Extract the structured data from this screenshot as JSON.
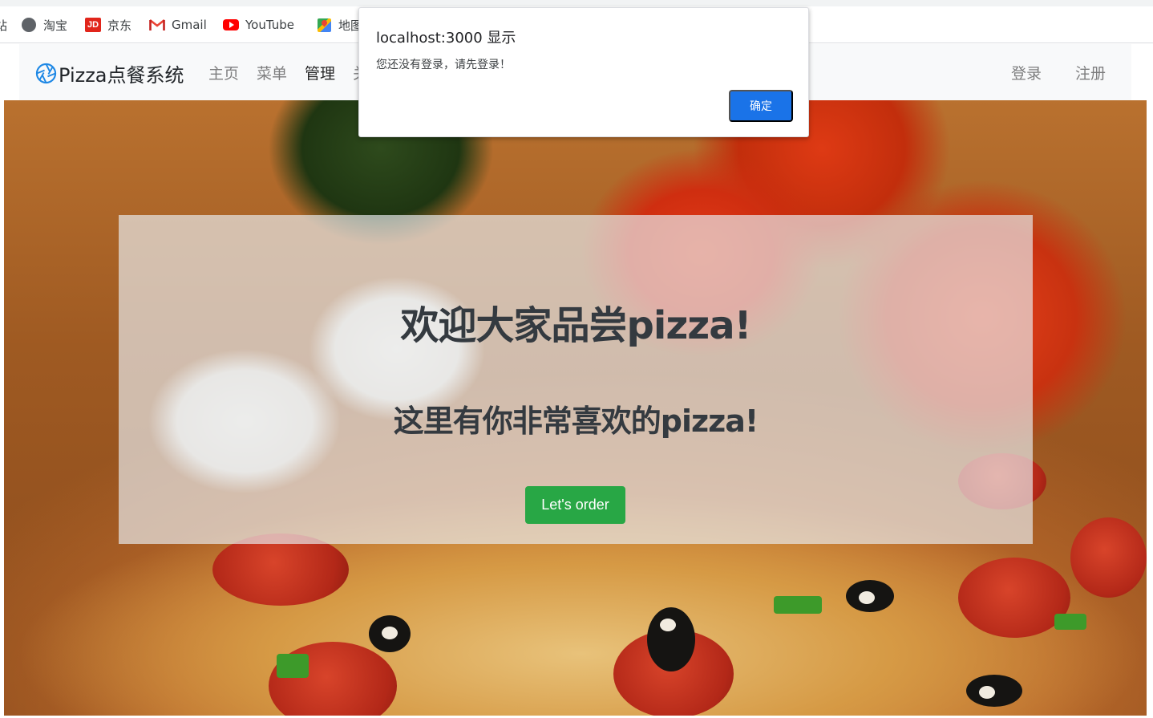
{
  "bookmarks": [
    {
      "label": "站",
      "icon": "bookmark-icon"
    },
    {
      "label": "淘宝",
      "icon": "globe-icon"
    },
    {
      "label": "京东",
      "icon": "jd-icon"
    },
    {
      "label": "Gmail",
      "icon": "gmail-icon"
    },
    {
      "label": "YouTube",
      "icon": "youtube-icon"
    },
    {
      "label": "地图",
      "icon": "maps-icon"
    }
  ],
  "navbar": {
    "brand": "Pizza点餐系统",
    "items": [
      "主页",
      "菜单",
      "管理",
      "关"
    ],
    "right": [
      "登录",
      "注册"
    ]
  },
  "hero": {
    "title": "欢迎大家品尝pizza!",
    "subtitle": "这里有你非常喜欢的pizza!",
    "button": "Let's order"
  },
  "dialog": {
    "title": "localhost:3000 显示",
    "message": "您还没有登录，请先登录！",
    "ok": "确定"
  },
  "colors": {
    "success": "#28a745",
    "dialog_button": "#1a73e8",
    "navbar_bg": "#f8f9fa"
  }
}
